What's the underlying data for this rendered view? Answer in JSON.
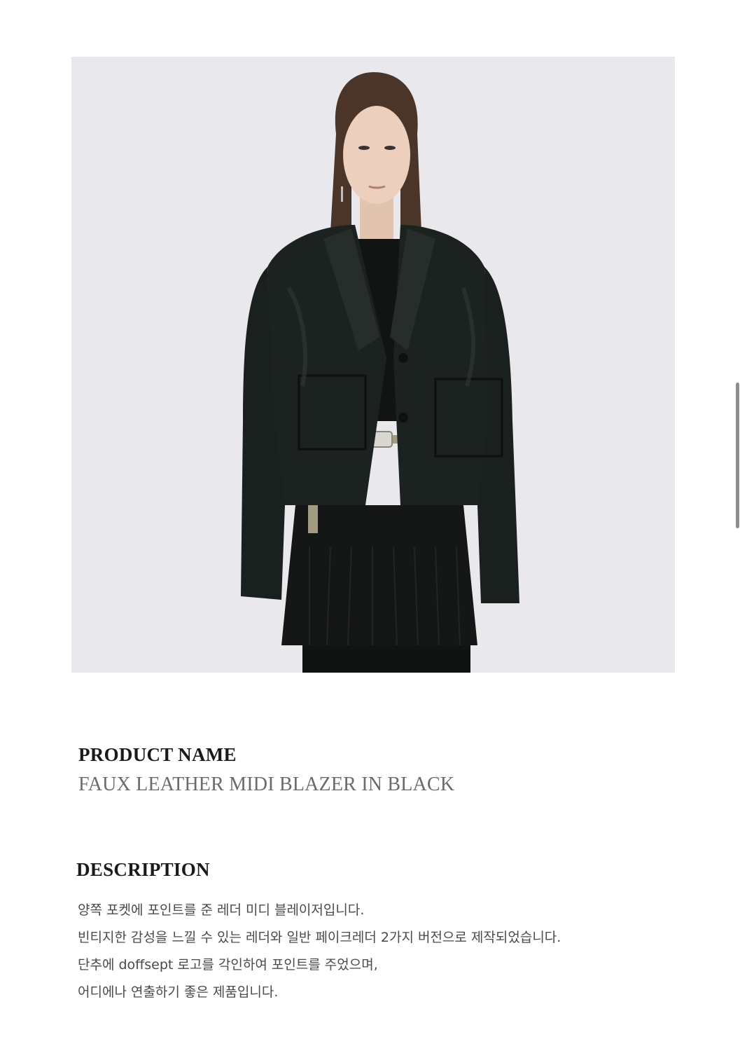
{
  "product_image": {
    "alt": "",
    "background": "#e9e8ec",
    "garment_color": "#1c2220"
  },
  "product_name": {
    "heading": "PRODUCT NAME",
    "value": "FAUX LEATHER MIDI BLAZER IN BLACK"
  },
  "description": {
    "heading": "DESCRIPTION",
    "lines": [
      "양쪽 포켓에 포인트를 준 레더 미디 블레이저입니다.",
      "빈티지한 감성을 느낄 수 있는 레더와 일반 페이크레더 2가지 버전으로 제작되었습니다.",
      "단추에 doffsept 로고를 각인하여 포인트를 주었으며,",
      "어디에나 연출하기 좋은 제품입니다."
    ]
  },
  "colors": {
    "heading_text": "#1a1a1a",
    "value_text": "#6b6b6b",
    "body_text": "#4a4a4a",
    "scrollbar": "#8e8e8e"
  }
}
